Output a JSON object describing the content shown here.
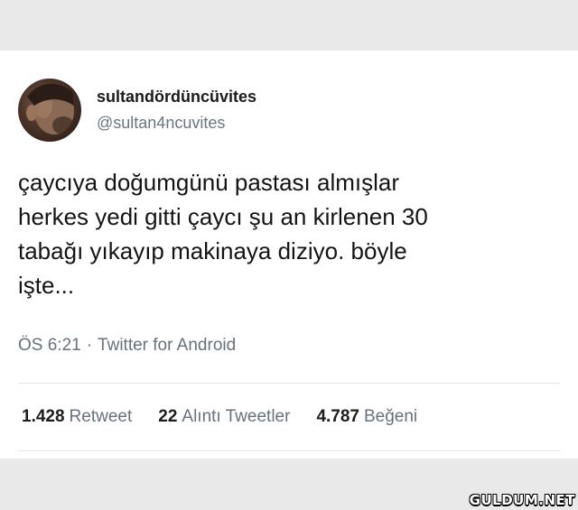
{
  "user": {
    "display_name": "sultandördüncüvites",
    "handle": "@sultan4ncuvites",
    "avatar_icon": "user-avatar"
  },
  "tweet": {
    "text": "çaycıya doğumgünü pastası almışlar\nherkes yedi gitti çaycı şu an kirlenen 30\ntabağı yıkayıp makinaya diziyo. böyle\nişte..."
  },
  "meta": {
    "time": "ÖS 6:21",
    "separator": "·",
    "source": "Twitter for Android"
  },
  "stats": [
    {
      "count": "1.428",
      "label": "Retweet"
    },
    {
      "count": "22",
      "label": "Alıntı Tweetler"
    },
    {
      "count": "4.787",
      "label": "Beğeni"
    }
  ],
  "watermark": "GULDUM.NET"
}
